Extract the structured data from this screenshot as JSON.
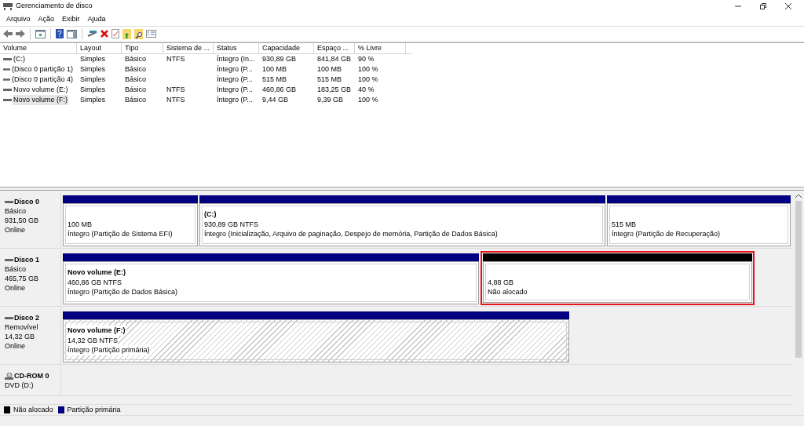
{
  "window": {
    "title": "Gerenciamento de disco"
  },
  "menu": [
    "Arquivo",
    "Ação",
    "Exibir",
    "Ajuda"
  ],
  "table": {
    "columns": [
      "Volume",
      "Layout",
      "Tipo",
      "Sistema de ...",
      "Status",
      "Capacidade",
      "Espaço ...",
      "% Livre"
    ],
    "rows": [
      {
        "cells": [
          "(C:)",
          "Simples",
          "Básico",
          "NTFS",
          "Íntegro (In...",
          "930,89 GB",
          "841,84 GB",
          "90 %"
        ],
        "selected": false
      },
      {
        "cells": [
          "(Disco 0 partição 1)",
          "Simples",
          "Básico",
          "",
          "Íntegro (P...",
          "100 MB",
          "100 MB",
          "100 %"
        ],
        "selected": false
      },
      {
        "cells": [
          "(Disco 0 partição 4)",
          "Simples",
          "Básico",
          "",
          "Íntegro (P...",
          "515 MB",
          "515 MB",
          "100 %"
        ],
        "selected": false
      },
      {
        "cells": [
          "Novo volume (E:)",
          "Simples",
          "Básico",
          "NTFS",
          "Íntegro (P...",
          "460,86 GB",
          "183,25 GB",
          "40 %"
        ],
        "selected": false
      },
      {
        "cells": [
          "Novo volume (F:)",
          "Simples",
          "Básico",
          "NTFS",
          "Íntegro (P...",
          "9,44 GB",
          "9,39 GB",
          "100 %"
        ],
        "selected": true
      }
    ]
  },
  "disks": [
    {
      "kind": "disk",
      "name": "Disco 0",
      "lines": [
        "Básico",
        "931,50 GB",
        "Online"
      ],
      "partitions": [
        {
          "kind": "primary",
          "lines": [
            "100 MB",
            "Íntegro (Partição de Sistema EFI)"
          ],
          "selected": false,
          "outlined": false
        },
        {
          "kind": "primary",
          "title": "(C:)",
          "lines": [
            "930,89 GB NTFS",
            "Íntegro (Inicialização, Arquivo de paginação, Despejo de memória, Partição de Dados Básica)"
          ],
          "selected": false,
          "outlined": false
        },
        {
          "kind": "primary",
          "lines": [
            "515 MB",
            "Íntegro (Partição de Recuperação)"
          ],
          "selected": false,
          "outlined": false
        }
      ]
    },
    {
      "kind": "disk",
      "name": "Disco 1",
      "lines": [
        "Básico",
        "465,75 GB",
        "Online"
      ],
      "partitions": [
        {
          "kind": "primary",
          "title": "Novo volume  (E:)",
          "lines": [
            "460,86 GB NTFS",
            "Íntegro (Partição de Dados Básica)"
          ],
          "selected": false,
          "outlined": false
        },
        {
          "kind": "unallocated",
          "lines": [
            "4,88 GB",
            "Não alocado"
          ],
          "selected": false,
          "outlined": true
        }
      ]
    },
    {
      "kind": "disk",
      "name": "Disco 2",
      "lines": [
        "Removível",
        "14,32 GB",
        "Online"
      ],
      "partitions": [
        {
          "kind": "primary",
          "title": "Novo volume  (F:)",
          "lines": [
            "14,32 GB NTFS",
            "Íntegro (Partição primária)"
          ],
          "selected": true,
          "outlined": false
        }
      ]
    },
    {
      "kind": "cdrom",
      "name": "CD-ROM 0",
      "lines": [
        "DVD (D:)"
      ]
    }
  ],
  "legend": [
    {
      "label": "Não alocado",
      "color": "#000000"
    },
    {
      "label": "Partição primária",
      "color": "#000080"
    }
  ]
}
